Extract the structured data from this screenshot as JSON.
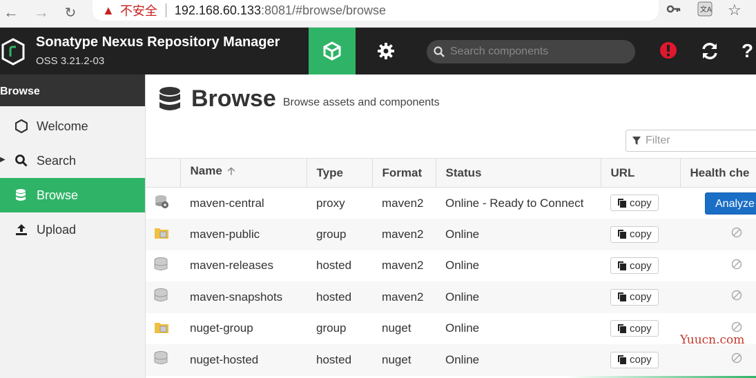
{
  "browser": {
    "security_label": "不安全",
    "url_host": "192.168.60.133",
    "url_rest": ":8081/#browse/browse"
  },
  "header": {
    "app_title": "Sonatype Nexus Repository Manager",
    "version": "OSS 3.21.2-03",
    "search_placeholder": "Search components"
  },
  "sidebar": {
    "heading": "Browse",
    "items": [
      {
        "label": "Welcome"
      },
      {
        "label": "Search"
      },
      {
        "label": "Browse"
      },
      {
        "label": "Upload"
      }
    ]
  },
  "main": {
    "title": "Browse",
    "subtitle": "Browse assets and components",
    "filter_placeholder": "Filter",
    "columns": {
      "name": "Name",
      "type": "Type",
      "format": "Format",
      "status": "Status",
      "url": "URL",
      "health": "Health che"
    },
    "copy_label": "copy",
    "analyze_label": "Analyze",
    "rows": [
      {
        "icon": "proxy-repo-icon",
        "name": "maven-central",
        "type": "proxy",
        "format": "maven2",
        "status": "Online - Ready to Connect"
      },
      {
        "icon": "group-repo-icon",
        "name": "maven-public",
        "type": "group",
        "format": "maven2",
        "status": "Online"
      },
      {
        "icon": "hosted-repo-icon",
        "name": "maven-releases",
        "type": "hosted",
        "format": "maven2",
        "status": "Online"
      },
      {
        "icon": "hosted-repo-icon",
        "name": "maven-snapshots",
        "type": "hosted",
        "format": "maven2",
        "status": "Online"
      },
      {
        "icon": "group-repo-icon",
        "name": "nuget-group",
        "type": "group",
        "format": "nuget",
        "status": "Online"
      },
      {
        "icon": "hosted-repo-icon",
        "name": "nuget-hosted",
        "type": "hosted",
        "format": "nuget",
        "status": "Online"
      }
    ]
  },
  "watermark": "Yuucn.com",
  "colors": {
    "accent": "#2fb467",
    "header_bg": "#212121",
    "analyze_button": "#1a6ec5",
    "alert": "#e0182d"
  }
}
